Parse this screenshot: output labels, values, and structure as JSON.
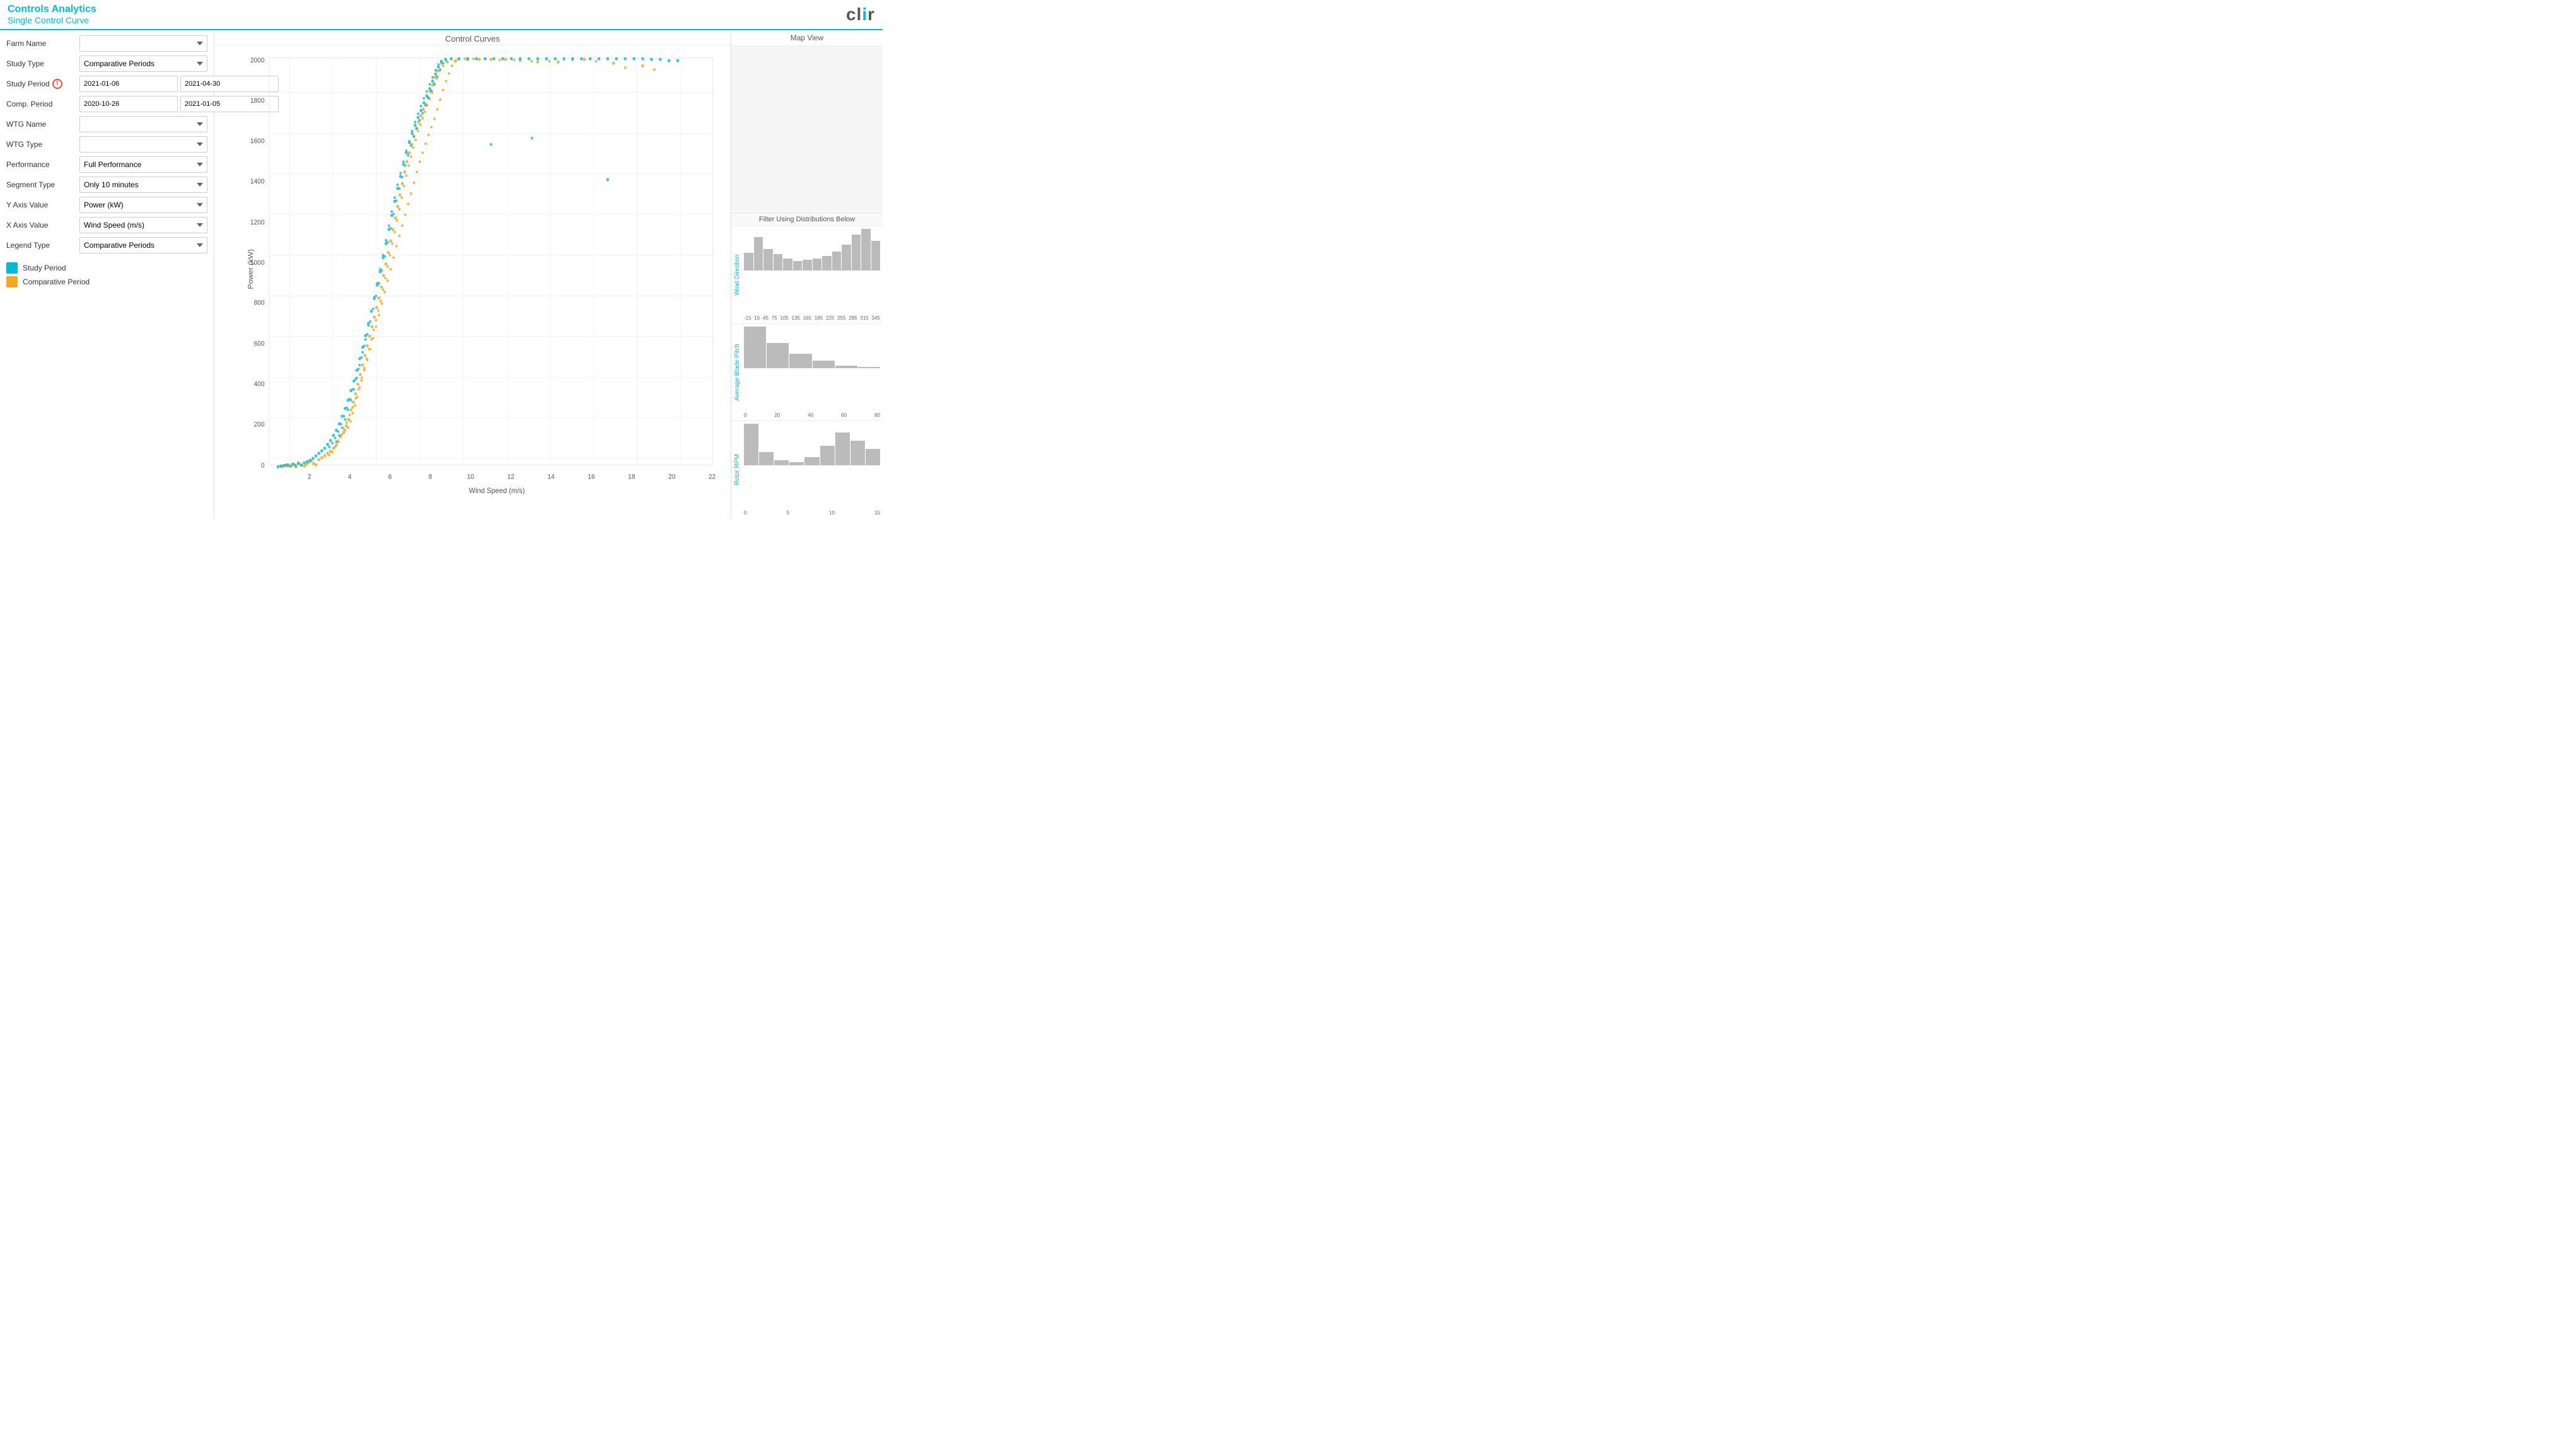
{
  "header": {
    "title_main": "Controls Analytics",
    "title_sub": "Single Control Curve",
    "logo": "clir"
  },
  "sidebar": {
    "farm_name_label": "Farm Name",
    "study_type_label": "Study Type",
    "study_period_label": "Study Period",
    "comp_period_label": "Comp. Period",
    "wtg_name_label": "WTG Name",
    "wtg_type_label": "WTG Type",
    "performance_label": "Performance",
    "segment_type_label": "Segment Type",
    "y_axis_label": "Y Axis Value",
    "x_axis_label": "X Axis Value",
    "legend_type_label": "Legend Type",
    "study_type_value": "Comparative Periods",
    "study_date_start": "2021-01-06",
    "study_date_end": "2021-04-30",
    "comp_date_start": "2020-10-26",
    "comp_date_end": "2021-01-05",
    "performance_value": "Full Performance",
    "segment_type_value": "Only 10 minutes",
    "y_axis_value": "Power (kW)",
    "x_axis_value": "Wind Speed (m/s)",
    "legend_type_value": "Comparative Periods"
  },
  "legend": {
    "study_period_label": "Study Period",
    "comp_period_label": "Comparative Period",
    "study_color": "#00bcd4",
    "comp_color": "#f5a623"
  },
  "chart": {
    "title": "Control Curves",
    "x_axis_label": "Wind Speed (m/s)",
    "y_axis_label": "Power (kW)",
    "y_ticks": [
      "0",
      "200",
      "400",
      "600",
      "800",
      "1000",
      "1200",
      "1400",
      "1600",
      "1800",
      "2000"
    ],
    "x_ticks": [
      "2",
      "4",
      "6",
      "8",
      "10",
      "12",
      "14",
      "16",
      "18",
      "20",
      "22"
    ]
  },
  "map": {
    "title": "Map View"
  },
  "filter": {
    "title": "Filter Using Distributions Below",
    "wind_direction_label": "Wind Direction",
    "wind_direction_x": [
      "-15",
      "15",
      "45",
      "75",
      "105",
      "135",
      "165",
      "195",
      "225",
      "255",
      "285",
      "315",
      "345"
    ],
    "wind_direction_bars": [
      15,
      28,
      18,
      14,
      10,
      8,
      9,
      10,
      12,
      16,
      22,
      30,
      35,
      25
    ],
    "avg_blade_pitch_label": "Average Blade Pitch",
    "avg_blade_pitch_x": [
      "0",
      "20",
      "40",
      "60",
      "80"
    ],
    "avg_blade_pitch_bars": [
      100,
      60,
      35,
      18,
      5,
      2
    ],
    "rotor_rpm_label": "Rotor RPM",
    "rotor_rpm_x": [
      "0",
      "5",
      "10",
      "15"
    ],
    "rotor_rpm_bars": [
      25,
      8,
      3,
      2,
      5,
      12,
      20,
      15,
      10
    ]
  }
}
